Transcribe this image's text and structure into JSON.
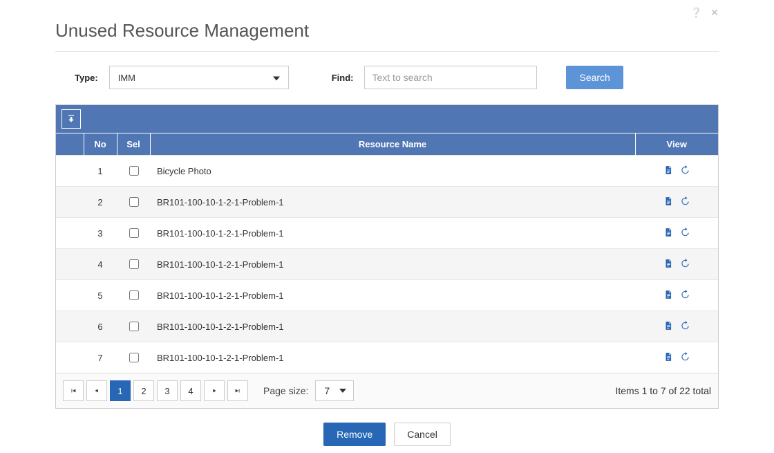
{
  "header": {
    "title": "Unused Resource Management"
  },
  "filters": {
    "type_label": "Type:",
    "type_value": "IMM",
    "find_label": "Find:",
    "find_placeholder": "Text to search",
    "search_label": "Search"
  },
  "table": {
    "columns": {
      "no": "No",
      "sel": "Sel",
      "name": "Resource Name",
      "view": "View"
    },
    "rows": [
      {
        "no": "1",
        "name": "Bicycle Photo"
      },
      {
        "no": "2",
        "name": "BR101-100-10-1-2-1-Problem-1"
      },
      {
        "no": "3",
        "name": "BR101-100-10-1-2-1-Problem-1"
      },
      {
        "no": "4",
        "name": "BR101-100-10-1-2-1-Problem-1"
      },
      {
        "no": "5",
        "name": "BR101-100-10-1-2-1-Problem-1"
      },
      {
        "no": "6",
        "name": "BR101-100-10-1-2-1-Problem-1"
      },
      {
        "no": "7",
        "name": "BR101-100-10-1-2-1-Problem-1"
      }
    ]
  },
  "pager": {
    "pages": [
      "1",
      "2",
      "3",
      "4"
    ],
    "active": "1",
    "page_size_label": "Page size:",
    "page_size_value": "7",
    "totals": "Items 1 to 7 of 22 total"
  },
  "actions": {
    "remove": "Remove",
    "cancel": "Cancel"
  }
}
